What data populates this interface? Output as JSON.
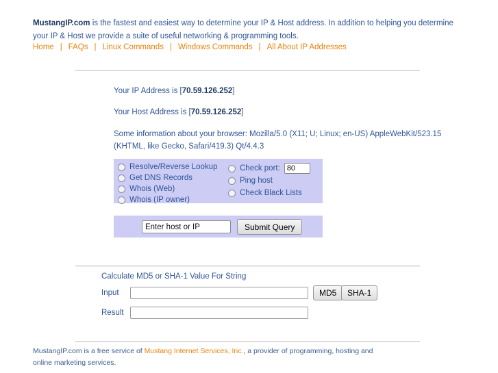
{
  "intro": {
    "brand": "MustangIP.com",
    "text": " is the fastest and easiest way to determine your IP & Host address. In addition to helping you determine your IP & Host we provide a suite of useful networking & programming tools."
  },
  "nav": {
    "items": [
      {
        "label": "Home"
      },
      {
        "label": "FAQs"
      },
      {
        "label": "Linux Commands"
      },
      {
        "label": "Windows Commands"
      },
      {
        "label": "All About IP Addresses"
      }
    ],
    "separator": "|"
  },
  "info": {
    "ip_label": "Your IP Address is [",
    "ip_value": "70.59.126.252",
    "ip_close": "]",
    "host_label": "Your Host Address is [",
    "host_value": "70.59.126.252",
    "host_close": "]",
    "browser": "Some information about your browser: Mozilla/5.0 (X11; U; Linux; en-US) AppleWebKit/523.15 (KHTML, like Gecko, Safari/419.3) Qt/4.4.3"
  },
  "options": {
    "left": [
      {
        "label": "Resolve/Reverse Lookup",
        "selected": false
      },
      {
        "label": "Get DNS Records",
        "selected": false
      },
      {
        "label": "Whois (Web)",
        "selected": false
      },
      {
        "label": "Whois (IP owner)",
        "selected": false
      }
    ],
    "right": [
      {
        "label": "Check port:",
        "selected": false
      },
      {
        "label": "Ping host",
        "selected": false
      },
      {
        "label": "Check Black Lists",
        "selected": false
      }
    ],
    "port_value": "80"
  },
  "query": {
    "host_value": "Enter host or IP",
    "submit_label": "Submit Query"
  },
  "hash": {
    "title": "Calculate MD5 or SHA-1 Value For String",
    "input_label": "Input",
    "result_label": "Result",
    "input_value": "",
    "result_value": "",
    "md5_label": "MD5",
    "sha1_label": "SHA-1"
  },
  "footer": {
    "text_before": "MustangIP.com is a free service of ",
    "link": "Mustang Internet Services, Inc.",
    "text_after": ", a provider of programming, hosting and online marketing services."
  },
  "colors": {
    "body_text": "#2f5596",
    "brand": "#1f3864",
    "link_orange": "#e8820c",
    "panel": "#ccccf4",
    "rule": "#c9c9c9"
  }
}
